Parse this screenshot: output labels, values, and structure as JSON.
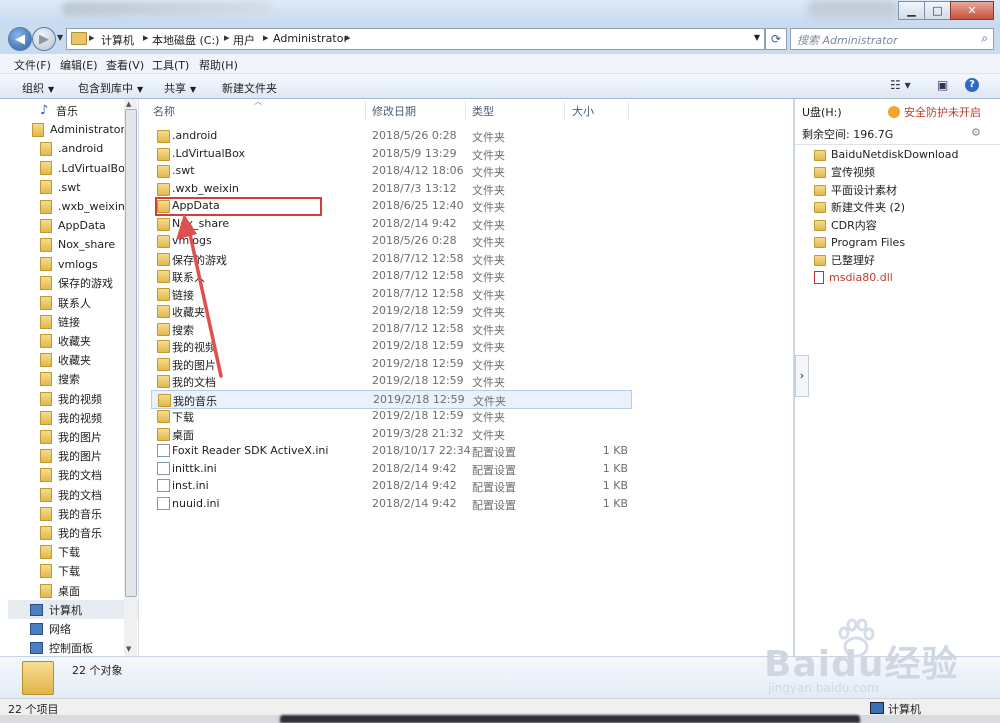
{
  "window": {
    "minimize": "▁",
    "maximize": "□",
    "close": "✕"
  },
  "address": {
    "crumbs": [
      "计算机",
      "本地磁盘 (C:)",
      "用户",
      "Administrator"
    ],
    "search_placeholder": "搜索 Administrator"
  },
  "menu": [
    "文件(F)",
    "编辑(E)",
    "查看(V)",
    "工具(T)",
    "帮助(H)"
  ],
  "toolbar": {
    "organize": "组织",
    "include": "包含到库中",
    "share": "共享",
    "new_folder": "新建文件夹",
    "help": "?"
  },
  "nav": [
    {
      "label": "音乐",
      "icon": "music-icon"
    },
    {
      "label": "Administrator",
      "icon": "user-folder-icon"
    },
    {
      "label": ".android",
      "icon": "folder-icon"
    },
    {
      "label": ".LdVirtualBox",
      "icon": "folder-icon"
    },
    {
      "label": ".swt",
      "icon": "folder-icon"
    },
    {
      "label": ".wxb_weixin",
      "icon": "folder-icon"
    },
    {
      "label": "AppData",
      "icon": "folder-icon"
    },
    {
      "label": "Nox_share",
      "icon": "folder-icon"
    },
    {
      "label": "vmlogs",
      "icon": "folder-icon"
    },
    {
      "label": "保存的游戏",
      "icon": "games-folder-icon"
    },
    {
      "label": "联系人",
      "icon": "contacts-folder-icon"
    },
    {
      "label": "链接",
      "icon": "links-folder-icon"
    },
    {
      "label": "收藏夹",
      "icon": "favorites-folder-icon"
    },
    {
      "label": "收藏夹",
      "icon": "favorites-folder-icon"
    },
    {
      "label": "搜索",
      "icon": "search-folder-icon"
    },
    {
      "label": "我的视频",
      "icon": "video-folder-icon"
    },
    {
      "label": "我的视频",
      "icon": "video-folder-icon"
    },
    {
      "label": "我的图片",
      "icon": "pictures-folder-icon"
    },
    {
      "label": "我的图片",
      "icon": "pictures-folder-icon"
    },
    {
      "label": "我的文档",
      "icon": "documents-folder-icon"
    },
    {
      "label": "我的文档",
      "icon": "documents-folder-icon"
    },
    {
      "label": "我的音乐",
      "icon": "music-folder-icon"
    },
    {
      "label": "我的音乐",
      "icon": "music-folder-icon"
    },
    {
      "label": "下载",
      "icon": "downloads-folder-icon"
    },
    {
      "label": "下载",
      "icon": "downloads-folder-icon"
    },
    {
      "label": "桌面",
      "icon": "desktop-folder-icon"
    },
    {
      "label": "计算机",
      "icon": "computer-icon"
    },
    {
      "label": "网络",
      "icon": "network-icon"
    },
    {
      "label": "控制面板",
      "icon": "control-panel-icon"
    }
  ],
  "columns": {
    "name": "名称",
    "date": "修改日期",
    "type": "类型",
    "size": "大小"
  },
  "files": [
    {
      "name": ".android",
      "date": "2018/5/26 0:28",
      "type": "文件夹",
      "size": "",
      "kind": "folder"
    },
    {
      "name": ".LdVirtualBox",
      "date": "2018/5/9 13:29",
      "type": "文件夹",
      "size": "",
      "kind": "folder"
    },
    {
      "name": ".swt",
      "date": "2018/4/12 18:06",
      "type": "文件夹",
      "size": "",
      "kind": "folder"
    },
    {
      "name": ".wxb_weixin",
      "date": "2018/7/3 13:12",
      "type": "文件夹",
      "size": "",
      "kind": "folder"
    },
    {
      "name": "AppData",
      "date": "2018/6/25 12:40",
      "type": "文件夹",
      "size": "",
      "kind": "folder"
    },
    {
      "name": "Nox_share",
      "date": "2018/2/14 9:42",
      "type": "文件夹",
      "size": "",
      "kind": "folder"
    },
    {
      "name": "vmlogs",
      "date": "2018/5/26 0:28",
      "type": "文件夹",
      "size": "",
      "kind": "folder"
    },
    {
      "name": "保存的游戏",
      "date": "2018/7/12 12:58",
      "type": "文件夹",
      "size": "",
      "kind": "folder"
    },
    {
      "name": "联系人",
      "date": "2018/7/12 12:58",
      "type": "文件夹",
      "size": "",
      "kind": "folder"
    },
    {
      "name": "链接",
      "date": "2018/7/12 12:58",
      "type": "文件夹",
      "size": "",
      "kind": "folder"
    },
    {
      "name": "收藏夹",
      "date": "2019/2/18 12:59",
      "type": "文件夹",
      "size": "",
      "kind": "folder"
    },
    {
      "name": "搜索",
      "date": "2018/7/12 12:58",
      "type": "文件夹",
      "size": "",
      "kind": "folder"
    },
    {
      "name": "我的视频",
      "date": "2019/2/18 12:59",
      "type": "文件夹",
      "size": "",
      "kind": "folder"
    },
    {
      "name": "我的图片",
      "date": "2019/2/18 12:59",
      "type": "文件夹",
      "size": "",
      "kind": "folder"
    },
    {
      "name": "我的文档",
      "date": "2019/2/18 12:59",
      "type": "文件夹",
      "size": "",
      "kind": "folder"
    },
    {
      "name": "我的音乐",
      "date": "2019/2/18 12:59",
      "type": "文件夹",
      "size": "",
      "kind": "folder",
      "hover": true
    },
    {
      "name": "下载",
      "date": "2019/2/18 12:59",
      "type": "文件夹",
      "size": "",
      "kind": "folder"
    },
    {
      "name": "桌面",
      "date": "2019/3/28 21:32",
      "type": "文件夹",
      "size": "",
      "kind": "folder"
    },
    {
      "name": "Foxit Reader SDK ActiveX.ini",
      "date": "2018/10/17 22:34",
      "type": "配置设置",
      "size": "1 KB",
      "kind": "ini"
    },
    {
      "name": "inittk.ini",
      "date": "2018/2/14 9:42",
      "type": "配置设置",
      "size": "1 KB",
      "kind": "ini"
    },
    {
      "name": "inst.ini",
      "date": "2018/2/14 9:42",
      "type": "配置设置",
      "size": "1 KB",
      "kind": "ini"
    },
    {
      "name": "nuuid.ini",
      "date": "2018/2/14 9:42",
      "type": "配置设置",
      "size": "1 KB",
      "kind": "ini"
    }
  ],
  "preview": {
    "drive": "U盘(H:)",
    "security": "安全防护未开启",
    "free": "剩余空间: 196.7G",
    "gear": "⚙",
    "toggle": "›",
    "items": [
      {
        "label": "BaiduNetdiskDownload",
        "kind": "folder"
      },
      {
        "label": "宣传视频",
        "kind": "folder"
      },
      {
        "label": "平面设计素材",
        "kind": "folder"
      },
      {
        "label": "新建文件夹 (2)",
        "kind": "folder"
      },
      {
        "label": "CDR内容",
        "kind": "folder"
      },
      {
        "label": "Program Files",
        "kind": "folder"
      },
      {
        "label": "已整理好",
        "kind": "folder"
      },
      {
        "label": "msdia80.dll",
        "kind": "dll"
      }
    ]
  },
  "details": {
    "count": "22 个对象"
  },
  "status": {
    "items": "22 个项目",
    "location": "计算机"
  },
  "watermark": {
    "brand": "Baidu经验",
    "url": "jingyan.baidu.com"
  },
  "colors": {
    "highlight_box": "#d43c3c",
    "arrow": "#e05050",
    "accent": "#2e6ac3"
  }
}
